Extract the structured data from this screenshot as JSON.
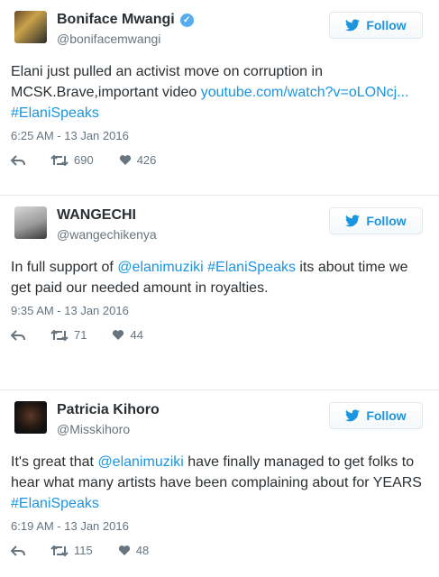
{
  "follow_label": "Follow",
  "colors": {
    "link": "#1b95e0",
    "muted": "#66757f",
    "text": "#292f33"
  },
  "tweets": [
    {
      "name": "Boniface Mwangi",
      "handle": "@bonifacemwangi",
      "verified": true,
      "text_part1": "Elani just pulled an activist move on corruption in MCSK.Brave,important video ",
      "link1": "youtube.com/watch?v=oLONcj...",
      "text_part2": " ",
      "link2": "#ElaniSpeaks",
      "text_part3": "",
      "timestamp": "6:25 AM - 13 Jan 2016",
      "retweets": "690",
      "likes": "426"
    },
    {
      "name": "WANGECHI",
      "handle": "@wangechikenya",
      "verified": false,
      "text_part1": "In full support of ",
      "link1": "@elanimuziki",
      "text_part2": " ",
      "link2": "#ElaniSpeaks",
      "text_part3": " its about time we get paid our needed amount in royalties.",
      "timestamp": "9:35 AM - 13 Jan 2016",
      "retweets": "71",
      "likes": "44"
    },
    {
      "name": "Patricia Kihoro",
      "handle": "@Misskihoro",
      "verified": false,
      "text_part1": "It's great that ",
      "link1": "@elanimuziki",
      "text_part2": " have finally managed to get folks to hear what many artists have been complaining about for YEARS ",
      "link2": "#ElaniSpeaks",
      "text_part3": "",
      "timestamp": "6:19 AM - 13 Jan 2016",
      "retweets": "115",
      "likes": "48"
    }
  ]
}
